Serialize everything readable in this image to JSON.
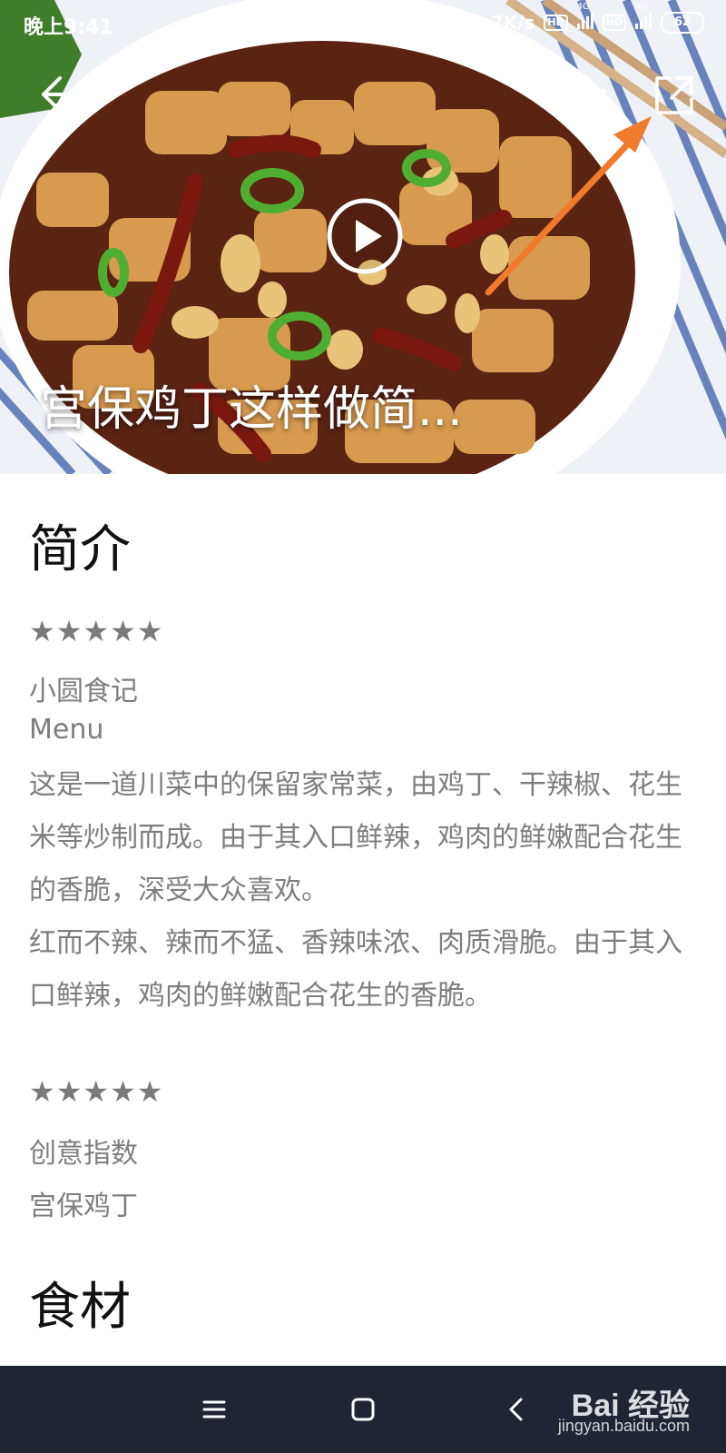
{
  "status_bar": {
    "time": "晚上9:41",
    "speed": "4.7K/s",
    "hd1": "HD",
    "hd2": "HD",
    "net1": "4G",
    "net2": "4G",
    "battery": "62"
  },
  "hero": {
    "title": "宫保鸡丁这样做简...",
    "icons": [
      "back-arrow-icon",
      "star-icon",
      "share-icon",
      "play-icon"
    ]
  },
  "intro": {
    "heading": "简介",
    "rating1": "★★★★★",
    "author": "小圆食记",
    "menu": "Menu",
    "paragraph1": "这是一道川菜中的保留家常菜，由鸡丁、干辣椒、花生米等炒制而成。由于其入口鲜辣，鸡肉的鲜嫩配合花生的香脆，深受大众喜欢。",
    "paragraph2": "红而不辣、辣而不猛、香辣味浓、肉质滑脆。由于其入口鲜辣，鸡肉的鲜嫩配合花生的香脆。",
    "rating2": "★★★★★",
    "creative_label": "创意指数",
    "dish_name": "宫保鸡丁"
  },
  "ingredients": {
    "heading": "食材"
  },
  "watermark": {
    "brand": "Bai  经验",
    "url": "jingyan.baidu.com"
  },
  "colors": {
    "annotation_arrow": "#f27a2c",
    "nav_bar": "#1f2533",
    "text_gray": "#7e7e7e"
  }
}
